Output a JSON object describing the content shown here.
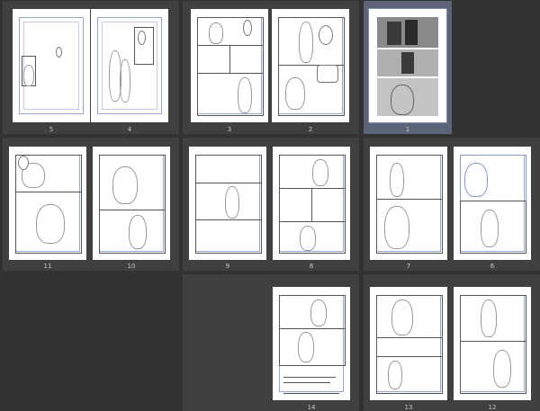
{
  "pages": {
    "p5": "5",
    "p4": "4",
    "p3": "3",
    "p2": "2",
    "p1": "1",
    "p11": "11",
    "p10": "10",
    "p9": "9",
    "p8": "8",
    "p7": "7",
    "p6": "6",
    "p14": "14",
    "p13": "13",
    "p12": "12"
  },
  "colors": {
    "background": "#323232",
    "spread": "#404040",
    "selected_spread": "#5c6478",
    "guide": "#8c96d0"
  }
}
